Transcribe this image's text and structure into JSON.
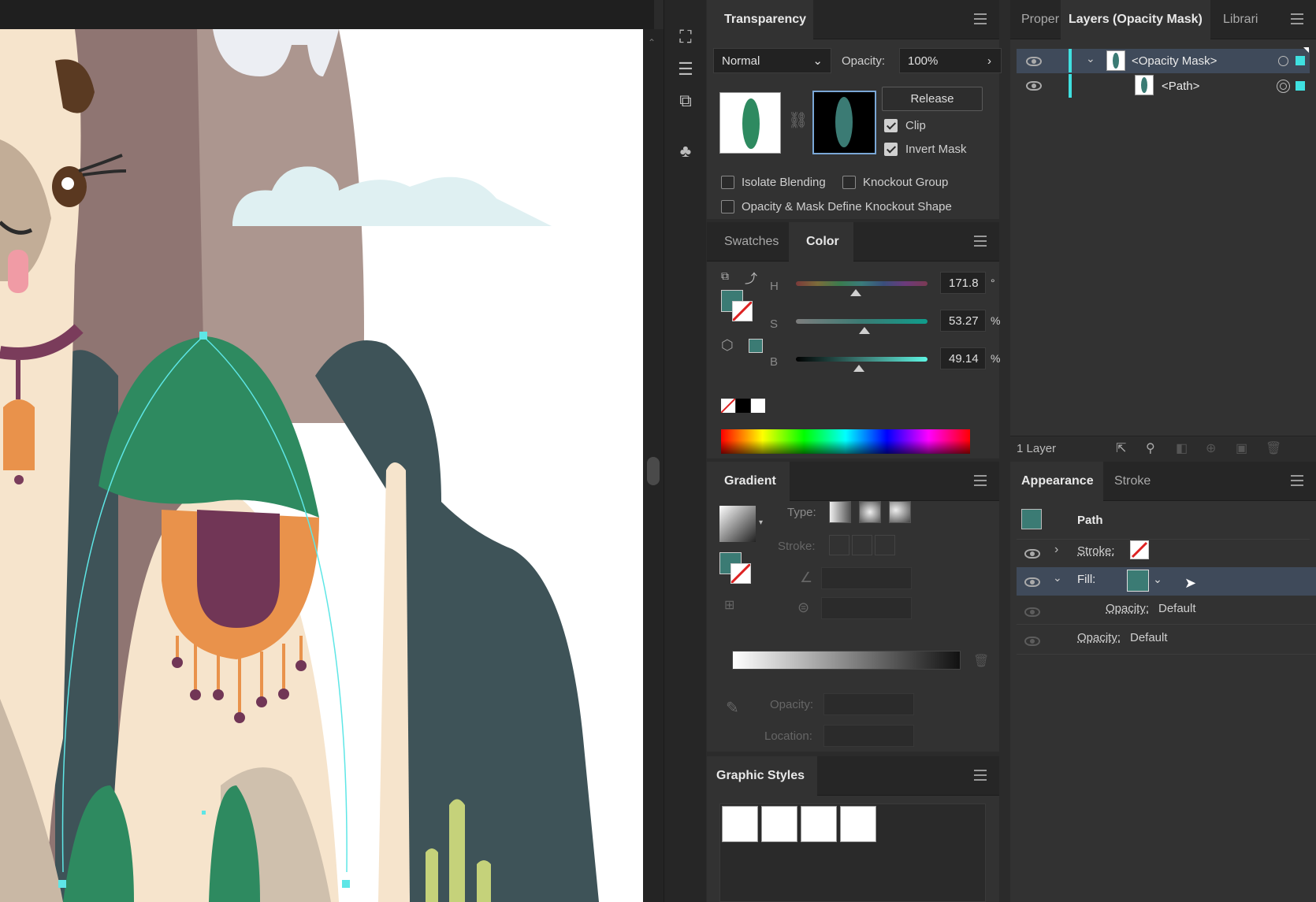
{
  "transparency": {
    "title": "Transparency",
    "blend_mode": "Normal",
    "opacity_label": "Opacity:",
    "opacity_value": "100%",
    "release_label": "Release",
    "clip_label": "Clip",
    "clip_checked": true,
    "invert_mask_label": "Invert Mask",
    "invert_mask_checked": true,
    "isolate_blending_label": "Isolate Blending",
    "knockout_group_label": "Knockout Group",
    "opacity_mask_knockout_label": "Opacity & Mask Define Knockout Shape"
  },
  "color_panel": {
    "tabs": [
      "Swatches",
      "Color"
    ],
    "active_tab": "Color",
    "h_label": "H",
    "h_value": "171.8",
    "h_unit": "°",
    "s_label": "S",
    "s_value": "53.27",
    "s_unit": "%",
    "b_label": "B",
    "b_value": "49.14",
    "b_unit": "%",
    "fill_color": "#3b7b74"
  },
  "gradient": {
    "title": "Gradient",
    "type_label": "Type:",
    "stroke_label": "Stroke:",
    "opacity_label": "Opacity:",
    "location_label": "Location:"
  },
  "graphic_styles": {
    "title": "Graphic Styles"
  },
  "layers": {
    "tabs": [
      "Proper",
      "Layers (Opacity Mask)",
      "Librari"
    ],
    "active_tab": "Layers (Opacity Mask)",
    "rows": [
      {
        "label": "<Opacity Mask>"
      },
      {
        "label": "<Path>"
      }
    ],
    "footer_count": "1 Layer"
  },
  "appearance": {
    "tabs": [
      "Appearance",
      "Stroke"
    ],
    "active_tab": "Appearance",
    "object_label": "Path",
    "stroke_label": "Stroke:",
    "fill_label": "Fill:",
    "fill_opacity_label": "Opacity:",
    "fill_opacity_value": "Default",
    "opacity_label": "Opacity:",
    "opacity_value": "Default"
  }
}
